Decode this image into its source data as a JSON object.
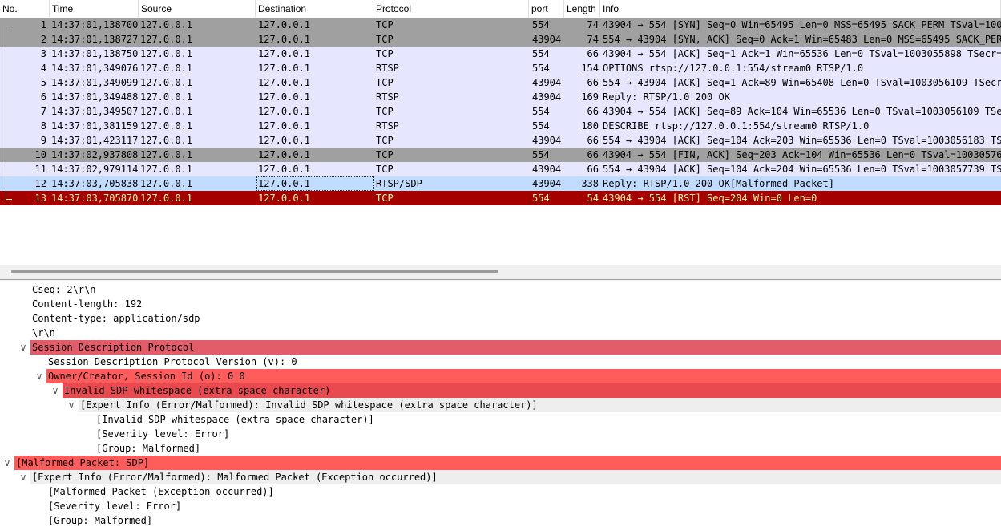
{
  "packet_list": {
    "columns": [
      {
        "label": "No."
      },
      {
        "label": "Time"
      },
      {
        "label": "Source"
      },
      {
        "label": "Destination"
      },
      {
        "label": "Protocol"
      },
      {
        "label": "port"
      },
      {
        "label": "Length"
      },
      {
        "label": "Info"
      }
    ],
    "rows": [
      {
        "no": "1",
        "time": "14:37:01,138700",
        "source": "127.0.0.1",
        "destination": "127.0.0.1",
        "protocol": "TCP",
        "port": "554",
        "length": "74",
        "info": "43904 → 554 [SYN] Seq=0 Win=65495 Len=0 MSS=65495 SACK_PERM TSval=10030",
        "style": "gray"
      },
      {
        "no": "2",
        "time": "14:37:01,138727",
        "source": "127.0.0.1",
        "destination": "127.0.0.1",
        "protocol": "TCP",
        "port": "43904",
        "length": "74",
        "info": "554 → 43904 [SYN, ACK] Seq=0 Ack=1 Win=65483 Len=0 MSS=65495 SACK_PERM",
        "style": "gray"
      },
      {
        "no": "3",
        "time": "14:37:01,138750",
        "source": "127.0.0.1",
        "destination": "127.0.0.1",
        "protocol": "TCP",
        "port": "554",
        "length": "66",
        "info": "43904 → 554 [ACK] Seq=1 Ack=1 Win=65536 Len=0 TSval=1003055898 TSecr=10",
        "style": "lav"
      },
      {
        "no": "4",
        "time": "14:37:01,349076",
        "source": "127.0.0.1",
        "destination": "127.0.0.1",
        "protocol": "RTSP",
        "port": "554",
        "length": "154",
        "info": "OPTIONS rtsp://127.0.0.1:554/stream0 RTSP/1.0",
        "style": "lav"
      },
      {
        "no": "5",
        "time": "14:37:01,349099",
        "source": "127.0.0.1",
        "destination": "127.0.0.1",
        "protocol": "TCP",
        "port": "43904",
        "length": "66",
        "info": "554 → 43904 [ACK] Seq=1 Ack=89 Win=65408 Len=0 TSval=1003056109 TSecr=1",
        "style": "lav"
      },
      {
        "no": "6",
        "time": "14:37:01,349488",
        "source": "127.0.0.1",
        "destination": "127.0.0.1",
        "protocol": "RTSP",
        "port": "43904",
        "length": "169",
        "info": "Reply: RTSP/1.0 200 OK",
        "style": "lav"
      },
      {
        "no": "7",
        "time": "14:37:01,349507",
        "source": "127.0.0.1",
        "destination": "127.0.0.1",
        "protocol": "TCP",
        "port": "554",
        "length": "66",
        "info": "43904 → 554 [ACK] Seq=89 Ack=104 Win=65536 Len=0 TSval=1003056109 TSecr",
        "style": "lav"
      },
      {
        "no": "8",
        "time": "14:37:01,381159",
        "source": "127.0.0.1",
        "destination": "127.0.0.1",
        "protocol": "RTSP",
        "port": "554",
        "length": "180",
        "info": "DESCRIBE rtsp://127.0.0.1:554/stream0 RTSP/1.0",
        "style": "lav"
      },
      {
        "no": "9",
        "time": "14:37:01,423117",
        "source": "127.0.0.1",
        "destination": "127.0.0.1",
        "protocol": "TCP",
        "port": "43904",
        "length": "66",
        "info": "554 → 43904 [ACK] Seq=104 Ack=203 Win=65536 Len=0 TSval=1003056183 TSec",
        "style": "lav"
      },
      {
        "no": "10",
        "time": "14:37:02,937808",
        "source": "127.0.0.1",
        "destination": "127.0.0.1",
        "protocol": "TCP",
        "port": "554",
        "length": "66",
        "info": "43904 → 554 [FIN, ACK] Seq=203 Ack=104 Win=65536 Len=0 TSval=1003057697",
        "style": "gray"
      },
      {
        "no": "11",
        "time": "14:37:02,979114",
        "source": "127.0.0.1",
        "destination": "127.0.0.1",
        "protocol": "TCP",
        "port": "43904",
        "length": "66",
        "info": "554 → 43904 [ACK] Seq=104 Ack=204 Win=65536 Len=0 TSval=1003057739 TSec",
        "style": "lav"
      },
      {
        "no": "12",
        "time": "14:37:03,705838",
        "source": "127.0.0.1",
        "destination": "127.0.0.1",
        "protocol": "RTSP/SDP",
        "port": "43904",
        "length": "338",
        "info": "Reply: RTSP/1.0 200 OK[Malformed Packet]",
        "style": "selected"
      },
      {
        "no": "13",
        "time": "14:37:03,705870",
        "source": "127.0.0.1",
        "destination": "127.0.0.1",
        "protocol": "TCP",
        "port": "554",
        "length": "54",
        "info": "43904 → 554 [RST] Seq=204 Win=0 Len=0",
        "style": "red"
      }
    ]
  },
  "details": {
    "rows": [
      {
        "text": "Cseq: 2\\r\\n",
        "indent": 40,
        "chevron": "",
        "band": ""
      },
      {
        "text": "Content-length: 192",
        "indent": 40,
        "chevron": "",
        "band": ""
      },
      {
        "text": "Content-type: application/sdp",
        "indent": 40,
        "chevron": "",
        "band": ""
      },
      {
        "text": "\\r\\n",
        "indent": 40,
        "chevron": "",
        "band": ""
      },
      {
        "text": "Session Description Protocol",
        "indent": 40,
        "chevron": "∨",
        "band": "sdp"
      },
      {
        "text": "Session Description Protocol Version (v): 0",
        "indent": 60,
        "chevron": "",
        "band": ""
      },
      {
        "text": "Owner/Creator, Session Id (o):  0 0",
        "indent": 60,
        "chevron": "∨",
        "band": "err"
      },
      {
        "text": "Invalid SDP whitespace (extra space character)",
        "indent": 80,
        "chevron": "∨",
        "band": "errdark"
      },
      {
        "text": "[Expert Info (Error/Malformed): Invalid SDP whitespace (extra space character)]",
        "indent": 100,
        "chevron": "∨",
        "band": "light"
      },
      {
        "text": "[Invalid SDP whitespace (extra space character)]",
        "indent": 120,
        "chevron": "",
        "band": ""
      },
      {
        "text": "[Severity level: Error]",
        "indent": 120,
        "chevron": "",
        "band": ""
      },
      {
        "text": "[Group: Malformed]",
        "indent": 120,
        "chevron": "",
        "band": ""
      },
      {
        "text": "[Malformed Packet: SDP]",
        "indent": 20,
        "chevron": "∨",
        "band": "err"
      },
      {
        "text": "[Expert Info (Error/Malformed): Malformed Packet (Exception occurred)]",
        "indent": 40,
        "chevron": "∨",
        "band": "light"
      },
      {
        "text": "[Malformed Packet (Exception occurred)]",
        "indent": 60,
        "chevron": "",
        "band": ""
      },
      {
        "text": "[Severity level: Error]",
        "indent": 60,
        "chevron": "",
        "band": ""
      },
      {
        "text": "[Group: Malformed]",
        "indent": 60,
        "chevron": "",
        "band": ""
      }
    ]
  },
  "colors": {
    "gray_row": "#a0a0a0",
    "lavender_row": "#e7e6ff",
    "selected_row": "#c0dcff",
    "red_row": "#a40000",
    "red_row_text": "#fffc9c",
    "sdp_band": "#e25c6a",
    "error_band": "#ff5c5c",
    "error_dark_band": "#e84a50",
    "expert_band": "#eeeeee"
  }
}
